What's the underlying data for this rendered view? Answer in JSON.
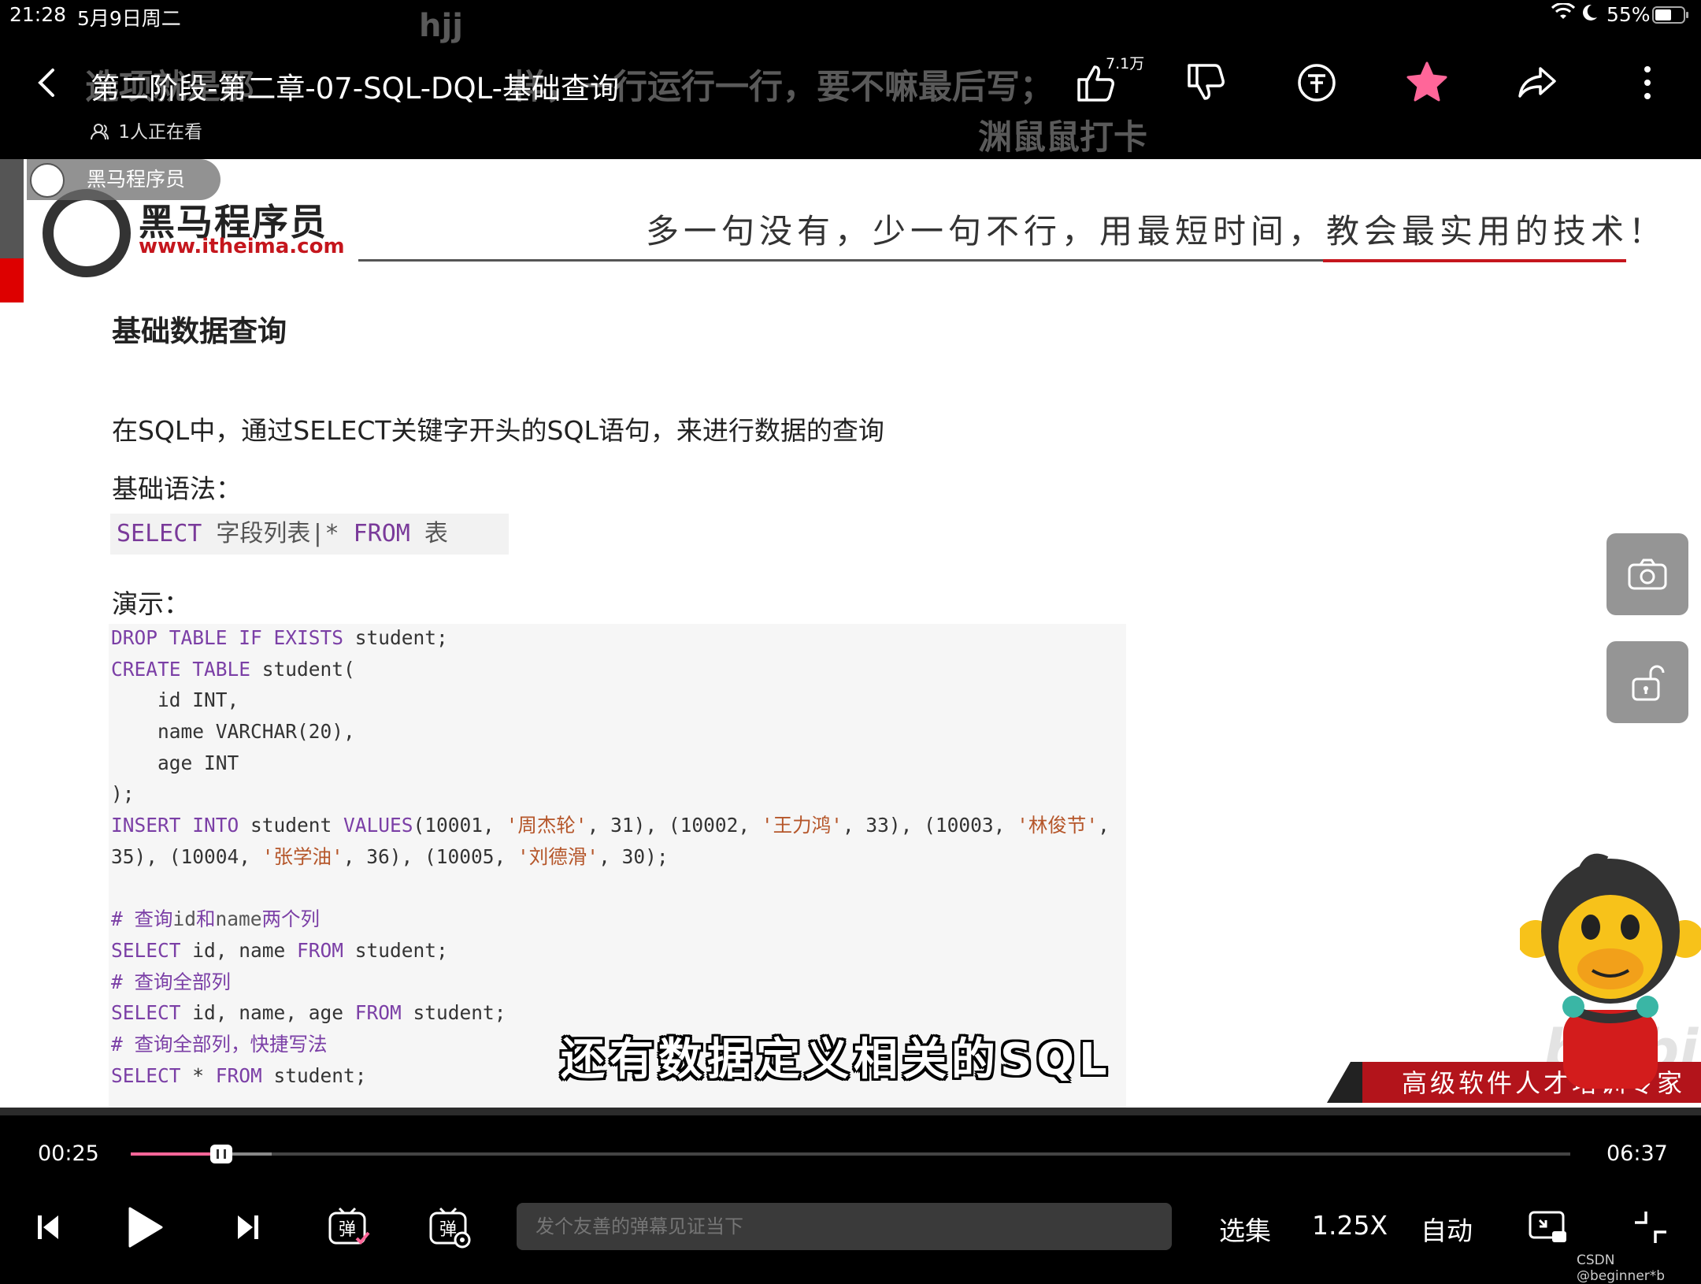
{
  "status": {
    "time": "21:28",
    "date": "5月9日周二",
    "battery": "55%"
  },
  "danmaku": {
    "d1": "hjj",
    "d2": "选项就是那",
    "d3": "样，一行运行一行，要不嘛最后写；",
    "d4": "渊鼠鼠打卡"
  },
  "header": {
    "title": "第二阶段-第二章-07-SQL-DQL-基础查询",
    "viewers": "1人正在看",
    "like_count": "7.1万"
  },
  "slide": {
    "watermark": "黑马程序员",
    "logo_name": "黑马程序员",
    "logo_url": "www.itheima.com",
    "slogan": "多一句没有，少一句不行，用最短时间，教会最实用的技术！",
    "heading": "基础数据查询",
    "intro": "在SQL中，通过SELECT关键字开头的SQL语句，来进行数据的查询",
    "syntax_label": "基础语法：",
    "syntax": {
      "kw1": "SELECT",
      "mid": " 字段列表|* ",
      "kw2": "FROM",
      "end": " 表"
    },
    "demo_label": "演示：",
    "code": {
      "l1_kw": "DROP TABLE IF EXISTS",
      "l1_rest": " student;",
      "l2_kw": "CREATE TABLE",
      "l2_rest": " student(",
      "l3": "    id INT,",
      "l4": "    name VARCHAR(20),",
      "l5": "    age INT",
      "l6": ");",
      "l7_a": "INSERT INTO",
      "l7_b": " student ",
      "l7_c": "VALUES",
      "l7_d": "(10001, ",
      "l7_s1": "'周杰轮'",
      "l7_e": ", 31), (10002, ",
      "l7_s2": "'王力鸿'",
      "l7_f": ", 33), (10003, ",
      "l7_s3": "'林俊节'",
      "l7_g": ",",
      "l8_a": "35), (10004, ",
      "l8_s1": "'张学油'",
      "l8_b": ", 36), (10005, ",
      "l8_s2": "'刘德滑'",
      "l8_c": ", 30);",
      "l10_a": "# 查询",
      "l10_b": "id",
      "l10_c": "和",
      "l10_d": "name",
      "l10_e": "两个列",
      "l11_kw": "SELECT",
      "l11_a": " id, name ",
      "l11_kw2": "FROM",
      "l11_b": " student;",
      "l12": "# 查询全部列",
      "l13_kw": "SELECT",
      "l13_a": " id, name, age ",
      "l13_kw2": "FROM",
      "l13_b": " student;",
      "l14": "# 查询全部列，快捷写法",
      "l15_kw": "SELECT",
      "l15_a": " * ",
      "l15_kw2": "FROM",
      "l15_b": " student;"
    },
    "subtitle": "还有数据定义相关的SQL",
    "banner": "高级软件人才培训专家",
    "bili": "bilibili"
  },
  "player": {
    "current_time": "00:25",
    "total_time": "06:37",
    "progress": 0.063,
    "buffered": 0.098,
    "danmaku_placeholder": "发个友善的弹幕见证当下",
    "episodes_label": "选集",
    "speed_label": "1.25X",
    "quality_label": "自动",
    "danmaku_toggle_label": "弹",
    "danmaku_settings_label": "弹"
  },
  "credit": "CSDN @beginner*b",
  "colors": {
    "accent": "#ff6699",
    "brand_red": "#c5161d",
    "keyword": "#7b3fa6",
    "string": "#b5562a"
  }
}
